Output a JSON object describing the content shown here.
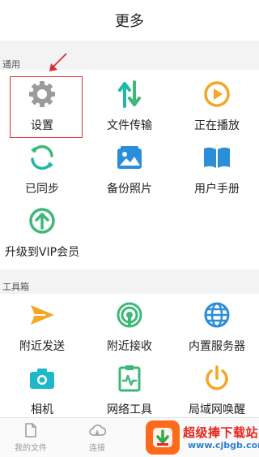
{
  "header": {
    "title": "更多"
  },
  "sections": [
    {
      "label": "通用",
      "items": [
        {
          "label": "设置",
          "icon": "gear-icon"
        },
        {
          "label": "文件传输",
          "icon": "transfer-arrows-icon"
        },
        {
          "label": "正在播放",
          "icon": "play-circle-icon"
        },
        {
          "label": "已同步",
          "icon": "sync-icon"
        },
        {
          "label": "备份照片",
          "icon": "photo-icon"
        },
        {
          "label": "用户手册",
          "icon": "book-icon"
        },
        {
          "label": "升级到VIP会员",
          "icon": "upgrade-arrow-icon"
        }
      ]
    },
    {
      "label": "工具箱",
      "items": [
        {
          "label": "附近发送",
          "icon": "paper-plane-icon"
        },
        {
          "label": "附近接收",
          "icon": "signal-receive-icon"
        },
        {
          "label": "内置服务器",
          "icon": "globe-icon"
        },
        {
          "label": "相机",
          "icon": "camera-icon"
        },
        {
          "label": "网络工具",
          "icon": "clipboard-pulse-icon"
        },
        {
          "label": "局域网唤醒",
          "icon": "power-icon"
        }
      ]
    }
  ],
  "tabbar": {
    "items": [
      {
        "label": "我的文件",
        "icon": "file-icon"
      },
      {
        "label": "连接",
        "icon": "cloud-icon"
      }
    ]
  },
  "watermark": {
    "title": "超级捧下载站",
    "url": "www.cjbgb.com"
  },
  "colors": {
    "gray_icon": "#9b9b9b",
    "green": "#3cb878",
    "teal": "#1fb8a8",
    "orange": "#f5a623",
    "blue": "#2b8ed8",
    "highlight_red": "#d9302e"
  }
}
